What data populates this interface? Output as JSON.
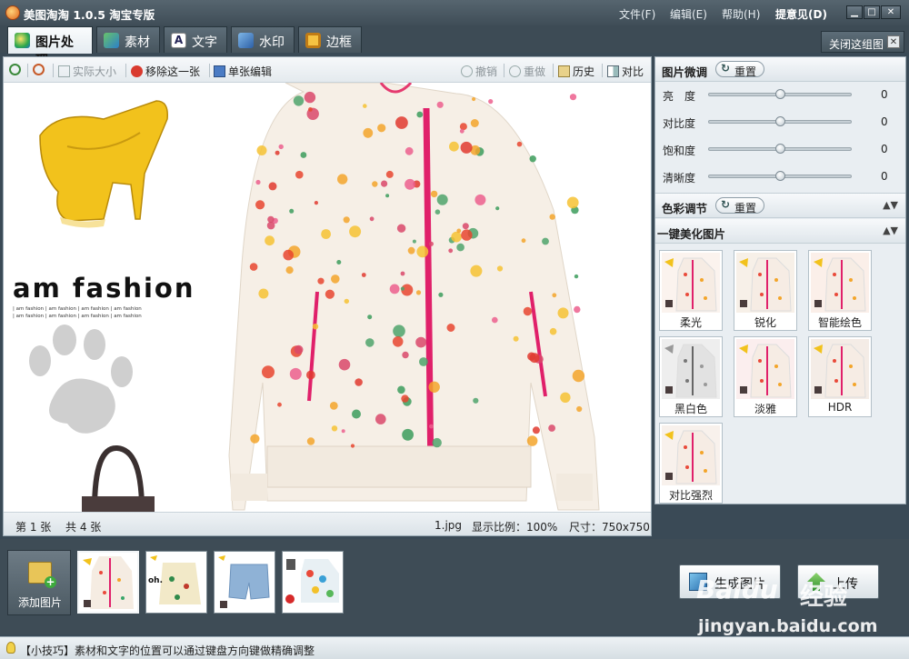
{
  "window": {
    "title": "美图淘淘 1.0.5 淘宝专版",
    "accent": "#3f4d57"
  },
  "menu": {
    "file": "文件(F)",
    "edit": "编辑(E)",
    "help": "帮助(H)",
    "feedback": "提意见(D)"
  },
  "window_controls": {
    "min": "▁",
    "max": "□",
    "close": "✕"
  },
  "tabs": [
    {
      "label": "图片处理",
      "active": true,
      "icon": "photo-edit-icon"
    },
    {
      "label": "素材",
      "active": false,
      "icon": "material-icon"
    },
    {
      "label": "文字",
      "active": false,
      "icon": "text-icon"
    },
    {
      "label": "水印",
      "active": false,
      "icon": "watermark-icon"
    },
    {
      "label": "边框",
      "active": false,
      "icon": "frame-icon"
    }
  ],
  "close_group": {
    "label": "关闭这组图",
    "x": "✕"
  },
  "toolbar": {
    "actual_size": "实际大小",
    "remove": "移除这一张",
    "single_edit": "单张编辑",
    "undo": "撤销",
    "redo": "重做",
    "history": "历史",
    "compare": "对比"
  },
  "canvas": {
    "brand_text": "am fashion",
    "brand_sub": "| am fashion | am fashion | am fashion | am fashion",
    "brand_sub2": "| am fashion | am fashion | am fashion | am fashion"
  },
  "status": {
    "current": "第 1 张",
    "total": "共 4 张",
    "filename": "1.jpg",
    "zoom": "显示比例：100%",
    "size": "尺寸：750x750"
  },
  "panel": {
    "fine_tune": {
      "title": "图片微调",
      "reset": "重置",
      "sliders": [
        {
          "label": "亮　度",
          "value": 0,
          "level": 0.5
        },
        {
          "label": "对比度",
          "value": 0,
          "level": 0.5
        },
        {
          "label": "饱和度",
          "value": 0,
          "level": 0.5
        },
        {
          "label": "清晰度",
          "value": 0,
          "level": 0.5
        }
      ]
    },
    "color": {
      "title": "色彩调节",
      "reset": "重置"
    },
    "beautify": {
      "title": "一键美化图片",
      "effects": [
        "柔光",
        "锐化",
        "智能绘色",
        "黑白色",
        "淡雅",
        "HDR",
        "对比强烈"
      ]
    }
  },
  "bottom": {
    "add_label": "添加图片",
    "generate": "生成图片",
    "upload": "上传"
  },
  "tip": "【小技巧】素材和文字的位置可以通过键盘方向键做精确调整",
  "watermark": {
    "logo": "Baidu",
    "text1": "经验",
    "url": "jingyan.baidu.com"
  }
}
